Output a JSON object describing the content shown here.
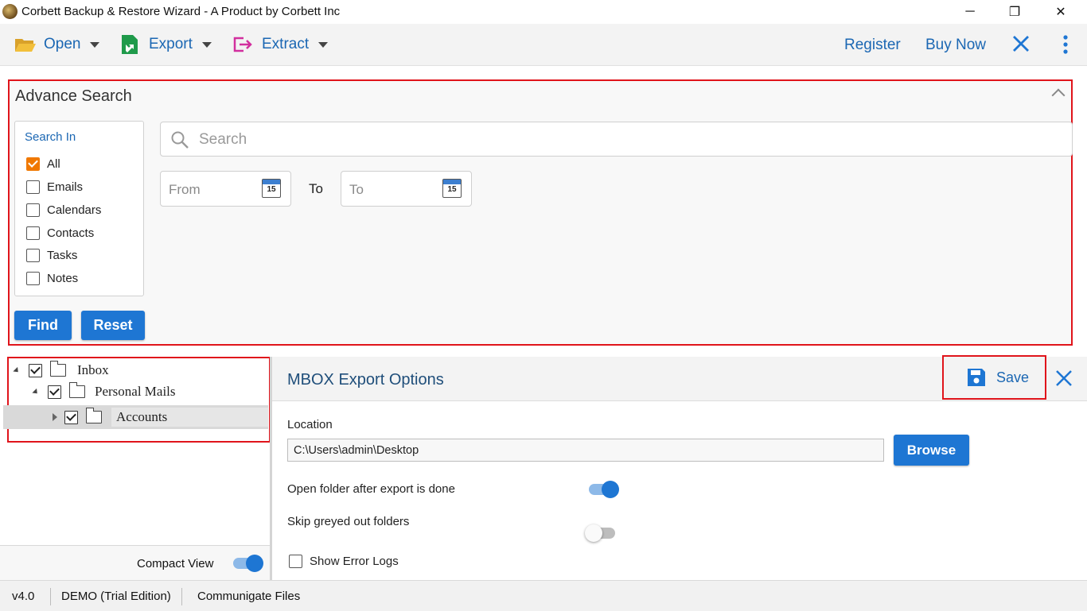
{
  "window": {
    "title": "Corbett Backup & Restore Wizard - A Product by Corbett Inc",
    "minimize": "─",
    "restore": "❐",
    "close": "✕"
  },
  "toolbar": {
    "open_label": "Open",
    "export_label": "Export",
    "extract_label": "Extract",
    "register_label": "Register",
    "buy_now_label": "Buy Now"
  },
  "advance_search": {
    "title": "Advance Search",
    "search_in_label": "Search In",
    "options": [
      {
        "label": "All",
        "checked": true
      },
      {
        "label": "Emails",
        "checked": false
      },
      {
        "label": "Calendars",
        "checked": false
      },
      {
        "label": "Contacts",
        "checked": false
      },
      {
        "label": "Tasks",
        "checked": false
      },
      {
        "label": "Notes",
        "checked": false
      }
    ],
    "find_label": "Find",
    "reset_label": "Reset",
    "search_placeholder": "Search",
    "from_placeholder": "From",
    "to_label": "To",
    "to_placeholder": "To",
    "calendar_day": "15"
  },
  "tree": [
    {
      "label": "Inbox",
      "checked": true
    },
    {
      "label": "Personal Mails",
      "checked": true
    },
    {
      "label": "Accounts",
      "checked": true
    }
  ],
  "compact_view": {
    "label": "Compact View",
    "on": true
  },
  "export_options": {
    "title": "MBOX Export Options",
    "save_label": "Save",
    "location_label": "Location",
    "location_value": "C:\\Users\\admin\\Desktop",
    "browse_label": "Browse",
    "open_folder_label": "Open folder after export is done",
    "open_folder_on": true,
    "skip_greyed_label": "Skip greyed out folders",
    "skip_greyed_on": false,
    "show_error_logs_label": "Show Error Logs",
    "show_error_logs_checked": false
  },
  "status": {
    "version": "v4.0",
    "edition": "DEMO (Trial Edition)",
    "mode": "Communigate Files"
  },
  "colors": {
    "accent": "#1e76d3",
    "highlight_border": "#e0141b",
    "checkbox_checked": "#f07800"
  }
}
